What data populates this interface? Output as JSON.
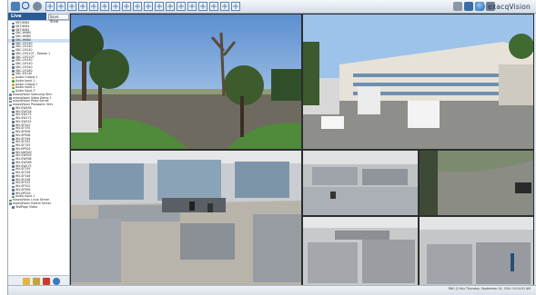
{
  "app": {
    "brand": "exacqVision",
    "brand_icon": "globe-icon"
  },
  "sidebar": {
    "tab_live": "Live Cameras",
    "tab_saveview": "Save View",
    "tree": [
      {
        "label": "SNT-6084",
        "level": 1,
        "kind": "cam"
      },
      {
        "label": "SNT-6084",
        "level": 1,
        "kind": "cam"
      },
      {
        "label": "SNT-6084",
        "level": 1,
        "kind": "cam"
      },
      {
        "label": "SNC-HM80",
        "level": 1,
        "kind": "cam"
      },
      {
        "label": "SNC-HM80",
        "level": 1,
        "kind": "cam"
      },
      {
        "label": "SNC-HM80",
        "level": 1,
        "kind": "cam",
        "selected": true
      },
      {
        "label": "SNC-CH140",
        "level": 1,
        "kind": "cam"
      },
      {
        "label": "SNC-CH140",
        "level": 1,
        "kind": "cam"
      },
      {
        "label": "SNC-CH240",
        "level": 1,
        "kind": "cam"
      },
      {
        "label": "SNC-CH210T - Stream 1",
        "level": 1,
        "kind": "cam"
      },
      {
        "label": "SNC-CH210T",
        "level": 1,
        "kind": "cam"
      },
      {
        "label": "SNC-CH140",
        "level": 1,
        "kind": "cam"
      },
      {
        "label": "SNC-CH140",
        "level": 1,
        "kind": "cam"
      },
      {
        "label": "SNC-CH240",
        "level": 1,
        "kind": "cam"
      },
      {
        "label": "SNC-CH180",
        "level": 1,
        "kind": "cam"
      },
      {
        "label": "SNC-EH140",
        "level": 1,
        "kind": "cam"
      },
      {
        "label": "Audio Output 1",
        "level": 1,
        "kind": "io"
      },
      {
        "label": "Audio Input 1",
        "level": 1,
        "kind": "aud"
      },
      {
        "label": "Audio Output 2",
        "level": 1,
        "kind": "io"
      },
      {
        "label": "Audio Input 2",
        "level": 1,
        "kind": "aud"
      },
      {
        "label": "Audio Input 3",
        "level": 1,
        "kind": "aud"
      },
      {
        "label": "exacqVision Samsung Serv",
        "level": 0,
        "kind": "server"
      },
      {
        "label": "exacqVision Video Demo 1",
        "level": 0,
        "kind": "server"
      },
      {
        "label": "exacqVision Pelco Server",
        "level": 0,
        "kind": "server"
      },
      {
        "label": "exacqVision Panasonic Serv",
        "level": 0,
        "kind": "server"
      },
      {
        "label": "WV-SW458",
        "level": 1,
        "kind": "cam"
      },
      {
        "label": "WV-SW316",
        "level": 1,
        "kind": "cam"
      },
      {
        "label": "WV-SW175",
        "level": 1,
        "kind": "cam"
      },
      {
        "label": "WV-SW172",
        "level": 1,
        "kind": "cam"
      },
      {
        "label": "WV-SW152",
        "level": 1,
        "kind": "cam"
      },
      {
        "label": "WV-SP102",
        "level": 1,
        "kind": "cam"
      },
      {
        "label": "WV-SF335",
        "level": 1,
        "kind": "cam"
      },
      {
        "label": "WV-SP306",
        "level": 1,
        "kind": "cam"
      },
      {
        "label": "WV-SP508",
        "level": 1,
        "kind": "cam"
      },
      {
        "label": "WV-SF346",
        "level": 1,
        "kind": "cam"
      },
      {
        "label": "WV-SF342",
        "level": 1,
        "kind": "cam"
      },
      {
        "label": "WV-SF135",
        "level": 1,
        "kind": "cam"
      },
      {
        "label": "WV-NP502",
        "level": 1,
        "kind": "cam"
      },
      {
        "label": "WV-NW502",
        "level": 1,
        "kind": "cam"
      },
      {
        "label": "WV-SW559",
        "level": 1,
        "kind": "cam"
      },
      {
        "label": "WV-SW598",
        "level": 1,
        "kind": "cam"
      },
      {
        "label": "WV-SW396",
        "level": 1,
        "kind": "cam"
      },
      {
        "label": "WV-SW175",
        "level": 1,
        "kind": "cam"
      },
      {
        "label": "WV-SF335",
        "level": 1,
        "kind": "cam"
      },
      {
        "label": "WV-SF336",
        "level": 1,
        "kind": "cam"
      },
      {
        "label": "WV-SF346",
        "level": 1,
        "kind": "cam"
      },
      {
        "label": "WV-SF438",
        "level": 1,
        "kind": "cam"
      },
      {
        "label": "WV-SF532",
        "level": 1,
        "kind": "cam"
      },
      {
        "label": "WV-SP102",
        "level": 1,
        "kind": "cam"
      },
      {
        "label": "WV-SP306",
        "level": 1,
        "kind": "cam"
      },
      {
        "label": "WV-NP244",
        "level": 1,
        "kind": "cam"
      },
      {
        "label": "Audio Input 1",
        "level": 1,
        "kind": "aud"
      },
      {
        "label": "exacqVision Linux Server",
        "level": 0,
        "kind": "server"
      },
      {
        "label": "exacqVision Hybrid Server",
        "level": 0,
        "kind": "server"
      },
      {
        "label": "TestPage Video",
        "level": 1,
        "kind": "cam"
      }
    ]
  },
  "toolbar": {
    "left_icons": [
      "monitor-icon",
      "search-icon",
      "gear-icon"
    ],
    "layout_count": 18,
    "right_icons": [
      "tools-icon",
      "camera-icon",
      "layout-icon",
      "list-icon"
    ]
  },
  "footer_icons": [
    "folder-icon",
    "lock-icon",
    "alarm-icon",
    "help-icon"
  ],
  "status": {
    "text": "RNG (3 fd)s    Thursday, September 04, 2014 10:24:52 AM"
  },
  "colors": {
    "chrome": "#dfe6ee",
    "accent": "#2a5a93",
    "video_bg": "#111111"
  },
  "tiles": [
    {
      "name": "camera-tile-palm-trees"
    },
    {
      "name": "camera-tile-office-building"
    },
    {
      "name": "camera-tile-office-floor-large"
    },
    {
      "name": "camera-tile-office-cubicles-top"
    },
    {
      "name": "camera-tile-parking-lot"
    },
    {
      "name": "camera-tile-office-cubicles-mid"
    },
    {
      "name": "camera-tile-office-cubicles-bottom"
    },
    {
      "name": "camera-tile-open-office"
    }
  ]
}
